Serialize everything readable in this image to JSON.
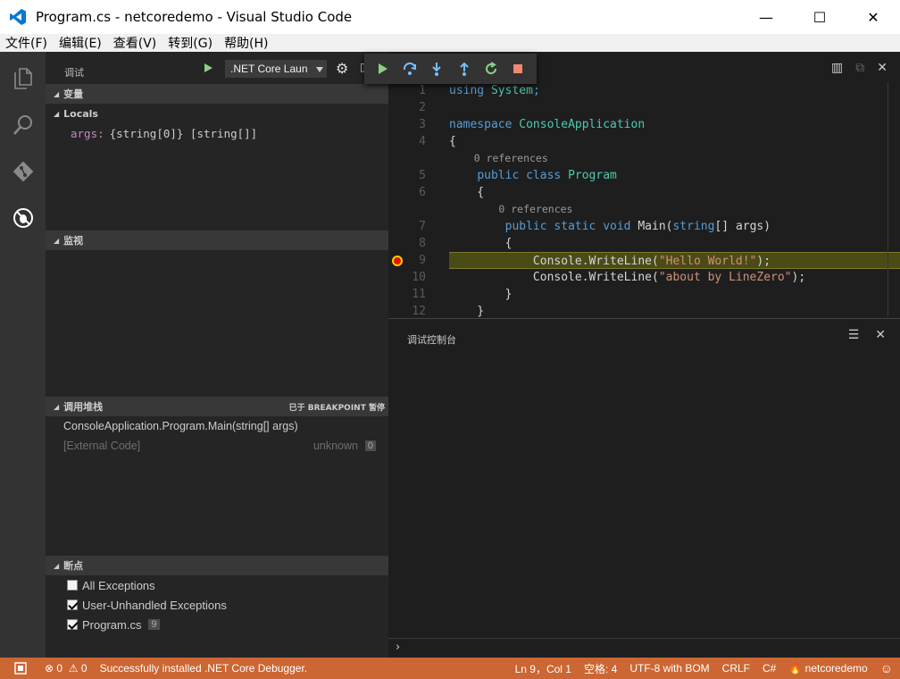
{
  "window": {
    "title": "Program.cs - netcoredemo - Visual Studio Code",
    "minimize": "—",
    "maximize": "☐",
    "close": "✕"
  },
  "menu": [
    "文件(F)",
    "编辑(E)",
    "查看(V)",
    "转到(G)",
    "帮助(H)"
  ],
  "sidebar": {
    "title": "调试",
    "launch_config": ".NET Core Laun",
    "sections": {
      "variables": "变量",
      "locals": "Locals",
      "var_name": "args:",
      "var_value": "{string[0]} [string[]]",
      "watch": "监视",
      "callstack": "调用堆栈",
      "callstack_status": "已于 BREAKPOINT 暂停",
      "breakpoints": "断点"
    },
    "callstack": [
      {
        "frame": "ConsoleApplication.Program.Main(string[] args)",
        "source": "",
        "line": ""
      },
      {
        "frame": "[External Code]",
        "source": "unknown",
        "line": "0"
      }
    ],
    "breakpoints": [
      {
        "label": "All Exceptions",
        "checked": false,
        "count": ""
      },
      {
        "label": "User-Unhandled Exceptions",
        "checked": true,
        "count": ""
      },
      {
        "label": "Program.cs",
        "checked": true,
        "count": "9"
      }
    ]
  },
  "debug_toolbar": [
    "continue-icon",
    "step-over-icon",
    "step-into-icon",
    "step-out-icon",
    "restart-icon",
    "stop-icon"
  ],
  "editor": {
    "lines": [
      {
        "n": "1",
        "code": [
          [
            "kw",
            "using "
          ],
          [
            "ty",
            "System"
          ],
          [
            "kw",
            ";"
          ]
        ]
      },
      {
        "n": "2",
        "code": []
      },
      {
        "n": "3",
        "code": [
          [
            "kw",
            "namespace "
          ],
          [
            "ty",
            "ConsoleApplication"
          ]
        ]
      },
      {
        "n": "4",
        "code": [
          [
            "pl",
            "{"
          ]
        ]
      },
      {
        "lens": "    0 references"
      },
      {
        "n": "5",
        "code": [
          [
            "pl",
            "    "
          ],
          [
            "kw",
            "public class "
          ],
          [
            "ty",
            "Program"
          ]
        ]
      },
      {
        "n": "6",
        "code": [
          [
            "pl",
            "    {"
          ]
        ]
      },
      {
        "lens": "        0 references"
      },
      {
        "n": "7",
        "code": [
          [
            "pl",
            "        "
          ],
          [
            "kw",
            "public static void "
          ],
          [
            "pl",
            "Main("
          ],
          [
            "kw",
            "string"
          ],
          [
            "pl",
            "[] "
          ],
          [
            "pl",
            "args)"
          ]
        ]
      },
      {
        "n": "8",
        "code": [
          [
            "pl",
            "        {"
          ]
        ]
      },
      {
        "n": "9",
        "code": [
          [
            "pl",
            "            Console.WriteLine("
          ],
          [
            "st",
            "\"Hello World!\""
          ],
          [
            "pl",
            ");"
          ]
        ],
        "highlight": true,
        "breakpoint": true
      },
      {
        "n": "10",
        "code": [
          [
            "pl",
            "            Console.WriteLine("
          ],
          [
            "st",
            "\"about by LineZero\""
          ],
          [
            "pl",
            ");"
          ]
        ]
      },
      {
        "n": "11",
        "code": [
          [
            "pl",
            "        }"
          ]
        ]
      },
      {
        "n": "12",
        "code": [
          [
            "pl",
            "    }"
          ]
        ]
      }
    ]
  },
  "panel": {
    "title": "调试控制台",
    "prompt": "›"
  },
  "status": {
    "errors": "0",
    "warnings": "0",
    "message": "Successfully installed .NET Core Debugger.",
    "position": "Ln 9，Col 1",
    "spaces": "空格: 4",
    "encoding": "UTF-8 with BOM",
    "eol": "CRLF",
    "language": "C#",
    "project": "netcoredemo"
  },
  "colors": {
    "statusbar": "#cc6633",
    "activitybar": "#333333",
    "sidebar": "#252526",
    "editor": "#1e1e1e"
  }
}
